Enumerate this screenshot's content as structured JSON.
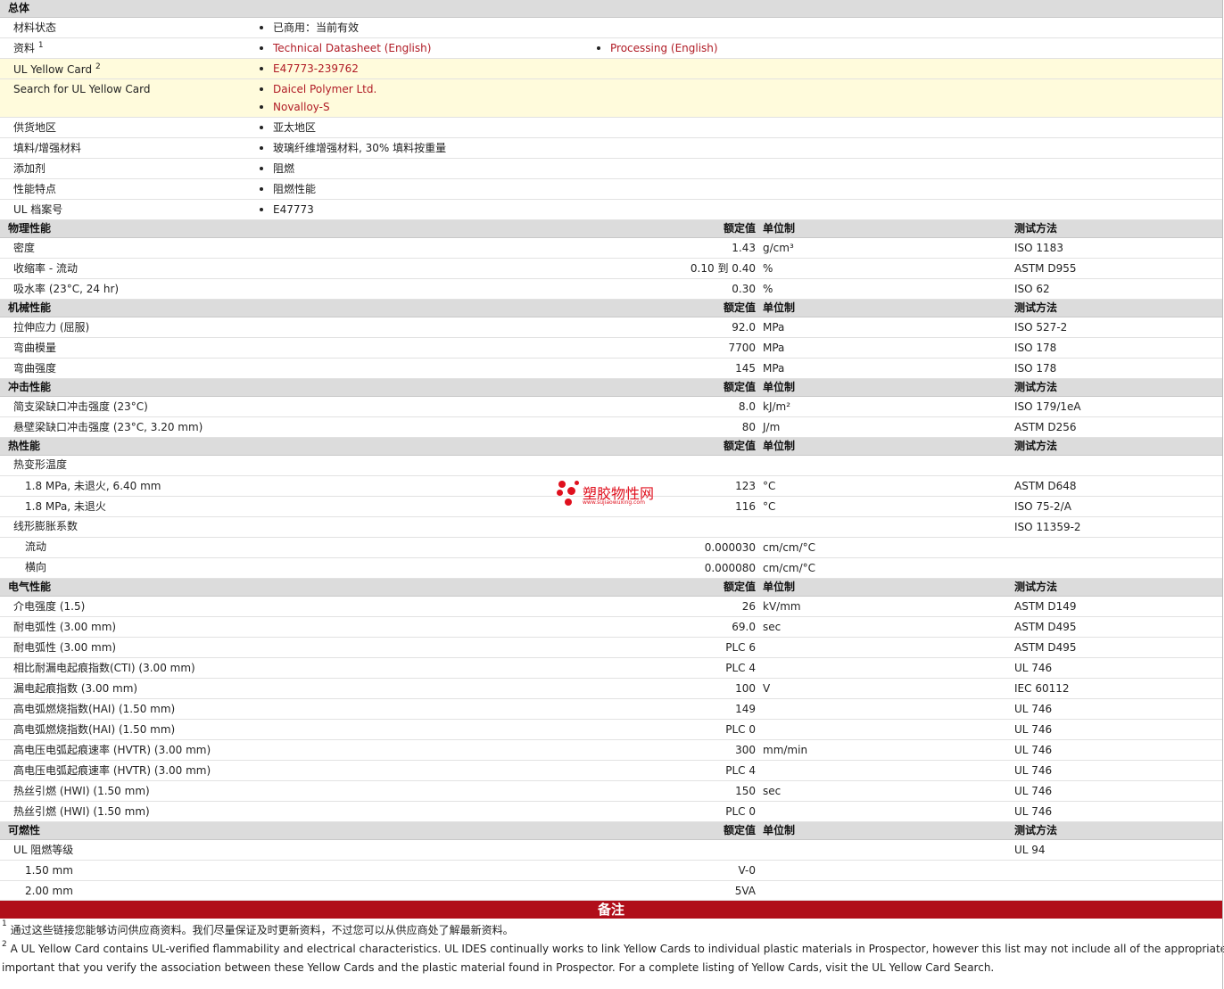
{
  "general": {
    "title": "总体",
    "rows": [
      {
        "label": "材料状态",
        "items": [
          "已商用：当前有效"
        ]
      },
      {
        "label": "资料",
        "sup": "1",
        "items": [
          "Technical Datasheet (English)"
        ],
        "items2": [
          "Processing (English)"
        ]
      },
      {
        "label": "UL Yellow Card",
        "sup": "2",
        "items": [
          "E47773-239762"
        ]
      },
      {
        "label": "Search for UL Yellow Card",
        "items": [
          "Daicel Polymer Ltd.",
          "Novalloy-S"
        ]
      },
      {
        "label": "供货地区",
        "items": [
          "亚太地区"
        ]
      },
      {
        "label": "填料/增强材料",
        "items": [
          "玻璃纤维增强材料, 30% 填料按重量"
        ]
      },
      {
        "label": "添加剂",
        "items": [
          "阻燃"
        ]
      },
      {
        "label": "性能特点",
        "items": [
          "阻燃性能"
        ]
      },
      {
        "label": "UL 档案号",
        "items": [
          "E47773"
        ]
      }
    ]
  },
  "columns": {
    "value": "额定值",
    "unit": "单位制",
    "test": "测试方法"
  },
  "sections": [
    {
      "title": "物理性能",
      "rows": [
        {
          "label": "密度",
          "value": "1.43",
          "unit": "g/cm³",
          "test": "ISO 1183"
        },
        {
          "label": "收缩率 - 流动",
          "value": "0.10 到 0.40",
          "unit": "%",
          "test": "ASTM D955"
        },
        {
          "label": "吸水率 (23°C, 24 hr)",
          "value": "0.30",
          "unit": "%",
          "test": "ISO 62"
        }
      ]
    },
    {
      "title": "机械性能",
      "rows": [
        {
          "label": "拉伸应力 (屈服)",
          "value": "92.0",
          "unit": "MPa",
          "test": "ISO 527-2"
        },
        {
          "label": "弯曲模量",
          "value": "7700",
          "unit": "MPa",
          "test": "ISO 178"
        },
        {
          "label": "弯曲强度",
          "value": "145",
          "unit": "MPa",
          "test": "ISO 178"
        }
      ]
    },
    {
      "title": "冲击性能",
      "rows": [
        {
          "label": "简支梁缺口冲击强度 (23°C)",
          "value": "8.0",
          "unit": "kJ/m²",
          "test": "ISO 179/1eA"
        },
        {
          "label": "悬壁梁缺口冲击强度 (23°C, 3.20 mm)",
          "value": "80",
          "unit": "J/m",
          "test": "ASTM D256"
        }
      ]
    },
    {
      "title": "热性能",
      "rows": [
        {
          "label": "热变形温度",
          "value": "",
          "unit": "",
          "test": ""
        },
        {
          "label": "1.8 MPa, 未退火, 6.40 mm",
          "indent": true,
          "value": "123",
          "unit": "°C",
          "test": "ASTM D648"
        },
        {
          "label": "1.8 MPa, 未退火",
          "indent": true,
          "value": "116",
          "unit": "°C",
          "test": "ISO 75-2/A"
        },
        {
          "label": "线形膨胀系数",
          "value": "",
          "unit": "",
          "test": "ISO 11359-2"
        },
        {
          "label": "流动",
          "indent": true,
          "value": "0.000030",
          "unit": "cm/cm/°C",
          "test": ""
        },
        {
          "label": "横向",
          "indent": true,
          "value": "0.000080",
          "unit": "cm/cm/°C",
          "test": ""
        }
      ]
    },
    {
      "title": "电气性能",
      "rows": [
        {
          "label": "介电强度 (1.5)",
          "value": "26",
          "unit": "kV/mm",
          "test": "ASTM D149"
        },
        {
          "label": "耐电弧性 (3.00 mm)",
          "value": "69.0",
          "unit": "sec",
          "test": "ASTM D495"
        },
        {
          "label": "耐电弧性 (3.00 mm)",
          "value": "PLC 6",
          "unit": "",
          "test": "ASTM D495"
        },
        {
          "label": "相比耐漏电起痕指数(CTI) (3.00 mm)",
          "value": "PLC 4",
          "unit": "",
          "test": "UL 746"
        },
        {
          "label": "漏电起痕指数 (3.00 mm)",
          "value": "100",
          "unit": "V",
          "test": "IEC 60112"
        },
        {
          "label": "高电弧燃烧指数(HAI) (1.50 mm)",
          "value": "149",
          "unit": "",
          "test": "UL 746"
        },
        {
          "label": "高电弧燃烧指数(HAI) (1.50 mm)",
          "value": "PLC 0",
          "unit": "",
          "test": "UL 746"
        },
        {
          "label": "高电压电弧起痕速率 (HVTR) (3.00 mm)",
          "value": "300",
          "unit": "mm/min",
          "test": "UL 746"
        },
        {
          "label": "高电压电弧起痕速率 (HVTR) (3.00 mm)",
          "value": "PLC 4",
          "unit": "",
          "test": "UL 746"
        },
        {
          "label": "热丝引燃 (HWI) (1.50 mm)",
          "value": "150",
          "unit": "sec",
          "test": "UL 746"
        },
        {
          "label": "热丝引燃 (HWI) (1.50 mm)",
          "value": "PLC 0",
          "unit": "",
          "test": "UL 746"
        }
      ]
    },
    {
      "title": "可燃性",
      "rows": [
        {
          "label": "UL 阻燃等级",
          "value": "",
          "unit": "",
          "test": "UL 94"
        },
        {
          "label": "1.50 mm",
          "indent": true,
          "value": "V-0",
          "unit": "",
          "test": ""
        },
        {
          "label": "2.00 mm",
          "indent": true,
          "value": "5VA",
          "unit": "",
          "test": ""
        }
      ]
    }
  ],
  "notes": {
    "title": "备注",
    "items": [
      {
        "sup": "1",
        "text": "通过这些链接您能够访问供应商资料。我们尽量保证及时更新资料，不过您可以从供应商处了解最新资料。"
      },
      {
        "sup": "2",
        "text": "A UL Yellow Card contains UL-verified flammability and electrical characteristics. UL IDES continually works to link Yellow Cards to individual plastic materials in Prospector, however this list may not include all of the appropriate links."
      },
      {
        "sup": "",
        "text": "important that you verify the association between these Yellow Cards and the plastic material found in Prospector. For a complete listing of Yellow Cards, visit the UL Yellow Card Search."
      }
    ]
  },
  "watermark": {
    "text": "塑胶物性网",
    "url": "www.sujiaowuxing.com",
    "color": "#e0101e"
  },
  "colors": {
    "link": "#b01b25",
    "section_bg": "#dcdcdc",
    "yellow_bg": "#fffbdc",
    "notes_bar": "#b00e1a"
  }
}
